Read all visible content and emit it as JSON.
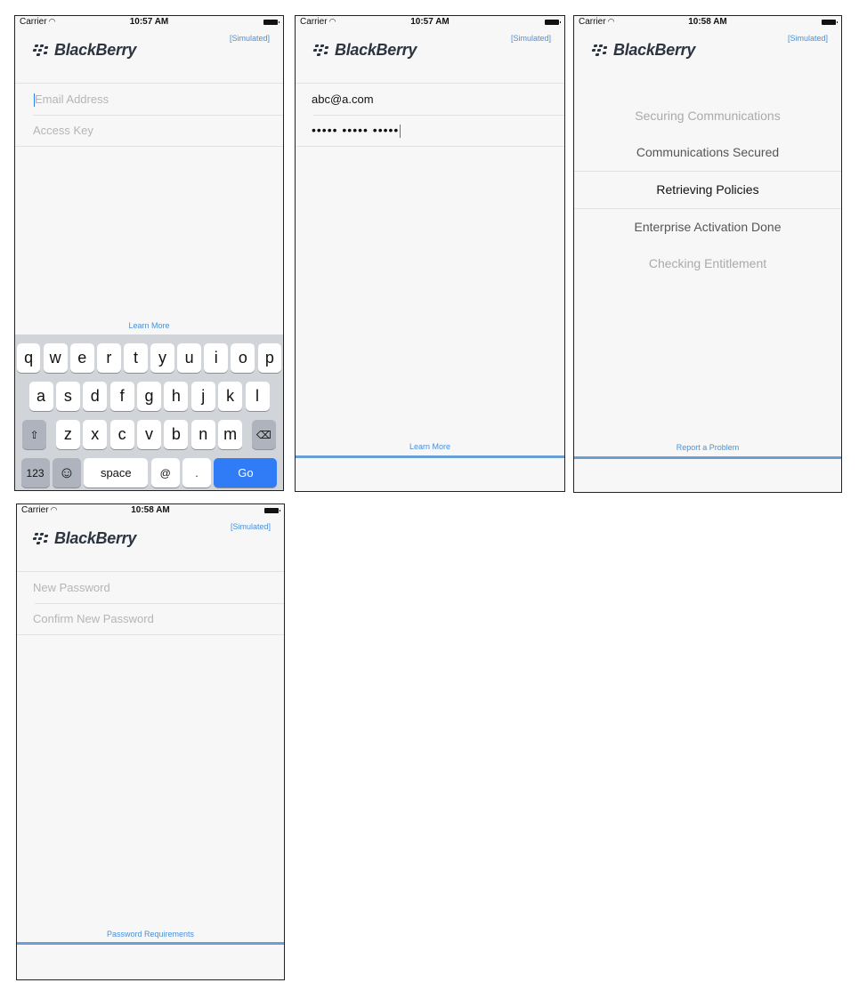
{
  "screens": [
    {
      "status": {
        "carrier": "Carrier",
        "time": "10:57 AM"
      },
      "simulated": "[Simulated]",
      "logo": "BlackBerry",
      "fields": [
        {
          "placeholder": "Email Address",
          "value": ""
        },
        {
          "placeholder": "Access Key",
          "value": ""
        }
      ],
      "footer_link": "Learn More"
    },
    {
      "status": {
        "carrier": "Carrier",
        "time": "10:57 AM"
      },
      "simulated": "[Simulated]",
      "logo": "BlackBerry",
      "fields": [
        {
          "placeholder": "",
          "value": "abc@a.com"
        },
        {
          "placeholder": "",
          "value": "••••• ••••• •••••"
        }
      ],
      "footer_link": "Learn More"
    },
    {
      "status": {
        "carrier": "Carrier",
        "time": "10:58 AM"
      },
      "simulated": "[Simulated]",
      "logo": "BlackBerry",
      "steps": [
        "Securing Communications",
        "Communications Secured",
        "Retrieving Policies",
        "Enterprise Activation Done",
        "Checking Entitlement"
      ],
      "footer_link": "Report a Problem"
    },
    {
      "status": {
        "carrier": "Carrier",
        "time": "10:58 AM"
      },
      "simulated": "[Simulated]",
      "logo": "BlackBerry",
      "fields": [
        {
          "placeholder": "New Password",
          "value": ""
        },
        {
          "placeholder": "Confirm New Password",
          "value": ""
        }
      ],
      "footer_link": "Password Requirements"
    }
  ],
  "keyboard": {
    "row1": [
      "q",
      "w",
      "e",
      "r",
      "t",
      "y",
      "u",
      "i",
      "o",
      "p"
    ],
    "row2": [
      "a",
      "s",
      "d",
      "f",
      "g",
      "h",
      "j",
      "k",
      "l"
    ],
    "row3": [
      "z",
      "x",
      "c",
      "v",
      "b",
      "n",
      "m"
    ],
    "shift_icon": "shift-icon",
    "delete_icon": "delete-icon",
    "numbers": "123",
    "emoji_icon": "emoji-icon",
    "space": "space",
    "at": "@",
    "dot": ".",
    "go": "Go"
  },
  "colors": {
    "accent": "#4a90d9",
    "bar": "#6b9fd3",
    "go_key": "#2f7cf6",
    "logo": "#2b3440"
  }
}
